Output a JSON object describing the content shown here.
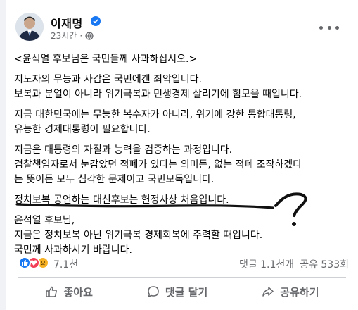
{
  "post": {
    "author": "이재명",
    "time": "23시간",
    "privacy_icon": "globe-icon",
    "verified_icon": "verified-badge-icon"
  },
  "body": {
    "lines": [
      "<윤석열 후보님은 국민들께 사과하십시오.>",
      "지도자의 무능과 사감은 국민에겐 죄악입니다.",
      "보복과 분열이 아니라 위기극복과 민생경제 살리기에 힘모을 때입니다.",
      "지금 대한민국에는 무능한 복수자가 아니라, 위기에 강한 통합대통령,",
      "유능한 경제대통령이 필요합니다.",
      "지금은 대통령의 자질과 능력을 검증하는 과정입니다.",
      "검찰책임자로서 눈감았던 적폐가 있다는 의미든, 없는 적폐 조작하겠다",
      "는 뜻이든 모두 심각한 문제이고 국민모독입니다.",
      "정치보복 공언하는 대선후보는 헌정사상 처음입니다.",
      "윤석열 후보님,",
      "지금은 정치보복 아닌 위기극복 경제회복에 주력할 때입니다.",
      "국민께 사과하시기 바랍니다."
    ],
    "annotation_mark": "?"
  },
  "stats": {
    "reactions": "7.1천",
    "comments": "댓글 1.1천개",
    "shares": "공유 533회"
  },
  "actions": {
    "like": "좋아요",
    "comment": "댓글 달기",
    "share": "공유하기"
  },
  "colors": {
    "accent": "#1877f2",
    "secondary_text": "#65676b",
    "love": "#f33e58",
    "sad": "#f7b125"
  }
}
